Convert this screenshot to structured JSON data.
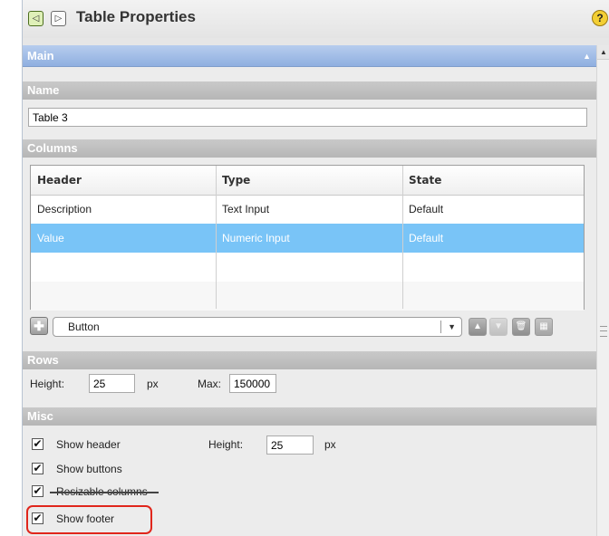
{
  "window": {
    "title": "Table Properties",
    "back_icon": "◁",
    "forward_icon": "▷",
    "help_icon": "?"
  },
  "main_section": {
    "label": "Main",
    "caret": "▲"
  },
  "name_section": {
    "label": "Name",
    "value": "Table 3"
  },
  "columns_section": {
    "label": "Columns",
    "headers": [
      "Header",
      "Type",
      "State"
    ],
    "rows": [
      [
        "Description",
        "Text Input",
        "Default"
      ],
      [
        "Value",
        "Numeric Input",
        "Default"
      ],
      [
        "",
        "",
        ""
      ],
      [
        "",
        "",
        ""
      ]
    ],
    "selected_row": 1,
    "add_icon": "✚",
    "type_value": "Button",
    "type_arrow": "▼",
    "up_icon": "▲",
    "down_icon": "▼",
    "delete_icon": "🗑",
    "grid_icon": "▦"
  },
  "rows_section": {
    "label": "Rows",
    "height_label": "Height:",
    "height_value": "25",
    "height_unit": "px",
    "max_label": "Max:",
    "max_value": "150000"
  },
  "misc_section": {
    "label": "Misc",
    "show_header": "Show header",
    "height_label": "Height:",
    "height_value": "25",
    "height_unit": "px",
    "show_buttons": "Show buttons",
    "resizable_columns": "Resizable columns",
    "show_footer": "Show footer",
    "check_mark": "✔"
  },
  "scrollbar": {
    "up_arrow": "▲"
  },
  "colors": {
    "main_bar": "#8fafe0",
    "selected_row": "#79c4f7",
    "highlight": "#e0261c"
  }
}
